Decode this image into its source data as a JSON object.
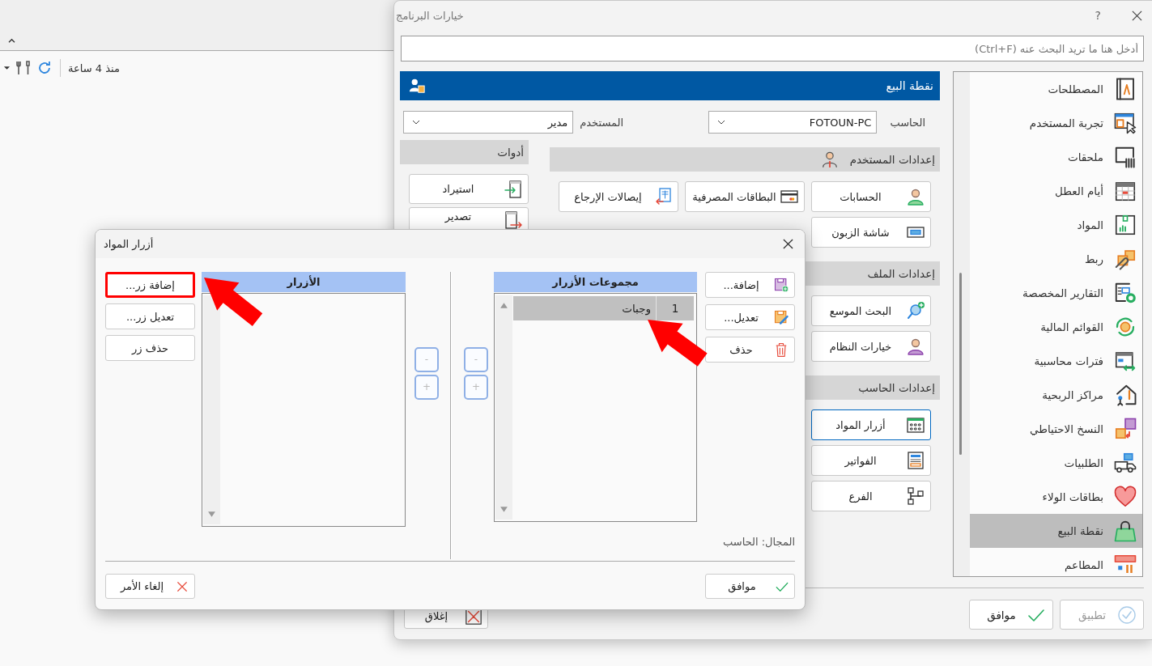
{
  "background_app": {
    "last_update": "منذ 4 ساعة"
  },
  "options_window": {
    "title": "خيارات البرنامج",
    "help": "?",
    "search": {
      "placeholder": "أدخل هنا ما تريد البحث عنه (Ctrl+F)"
    },
    "panel": {
      "title": "نقطة البيع",
      "computer": {
        "label": "الحاسب",
        "value": "FOTOUN-PC"
      },
      "user": {
        "label": "المستخدم",
        "value": "مدير"
      },
      "sections": [
        {
          "title": "إعدادات المستخدم",
          "kind": "grid",
          "buttons": [
            {
              "label": "الحسابات",
              "focused": false
            },
            {
              "label": "البطاقات المصرفية",
              "focused": false
            },
            {
              "label": "إيصالات الإرجاع",
              "focused": false
            },
            {
              "label": "شاشة الزبون",
              "focused": false
            }
          ]
        },
        {
          "title": "إعدادات الملف",
          "kind": "column",
          "buttons": [
            {
              "label": "البحث الموسع",
              "focused": false
            },
            {
              "label": "خيارات النظام",
              "focused": false
            }
          ]
        },
        {
          "title": "إعدادات الحاسب",
          "kind": "column",
          "buttons": [
            {
              "label": "أزرار المواد",
              "focused": true
            },
            {
              "label": "الفواتير",
              "focused": false
            },
            {
              "label": "الفرع",
              "focused": false
            }
          ]
        }
      ],
      "tools": {
        "title": "أدوات",
        "buttons": [
          "استيراد",
          "تصدير"
        ]
      }
    },
    "categories": [
      {
        "label": "المصطلحات",
        "selected": false
      },
      {
        "label": "تجربة المستخدم",
        "selected": false
      },
      {
        "label": "ملحقات",
        "selected": false
      },
      {
        "label": "أيام العطل",
        "selected": false
      },
      {
        "label": "المواد",
        "selected": false
      },
      {
        "label": "ربط",
        "selected": false
      },
      {
        "label": "التقارير المخصصة",
        "selected": false
      },
      {
        "label": "القوائم المالية",
        "selected": false
      },
      {
        "label": "فترات محاسبية",
        "selected": false
      },
      {
        "label": "مراكز الربحية",
        "selected": false
      },
      {
        "label": "النسخ الاحتياطي",
        "selected": false
      },
      {
        "label": "الطلبيات",
        "selected": false
      },
      {
        "label": "بطاقات الولاء",
        "selected": false
      },
      {
        "label": "نقطة البيع",
        "selected": true
      },
      {
        "label": "المطاعم",
        "selected": false
      }
    ],
    "close_button": "إغلاق",
    "buttons": [
      {
        "label": "تطبيق",
        "disabled": true
      },
      {
        "label": "موافق",
        "disabled": false
      }
    ]
  },
  "dialog": {
    "title": "أزرار المواد",
    "item_buttons": [
      {
        "label": "إضافة زر...",
        "highlighted": true
      },
      {
        "label": "تعديل زر...",
        "highlighted": false
      },
      {
        "label": "حذف زر",
        "highlighted": false
      }
    ],
    "items_list": {
      "header": "الأزرار"
    },
    "order_buttons_left": [
      "-",
      "+"
    ],
    "order_buttons_right": [
      "-",
      "+"
    ],
    "groups_list": {
      "header": "مجموعات الأزرار",
      "rows": [
        {
          "number": "1",
          "name": "وجبات",
          "selected": true
        }
      ]
    },
    "group_buttons": [
      "إضافة...",
      "تعديل...",
      "حذف"
    ],
    "scope": "المجال: الحاسب",
    "ok": "موافق",
    "cancel": "إلغاء الأمر"
  }
}
